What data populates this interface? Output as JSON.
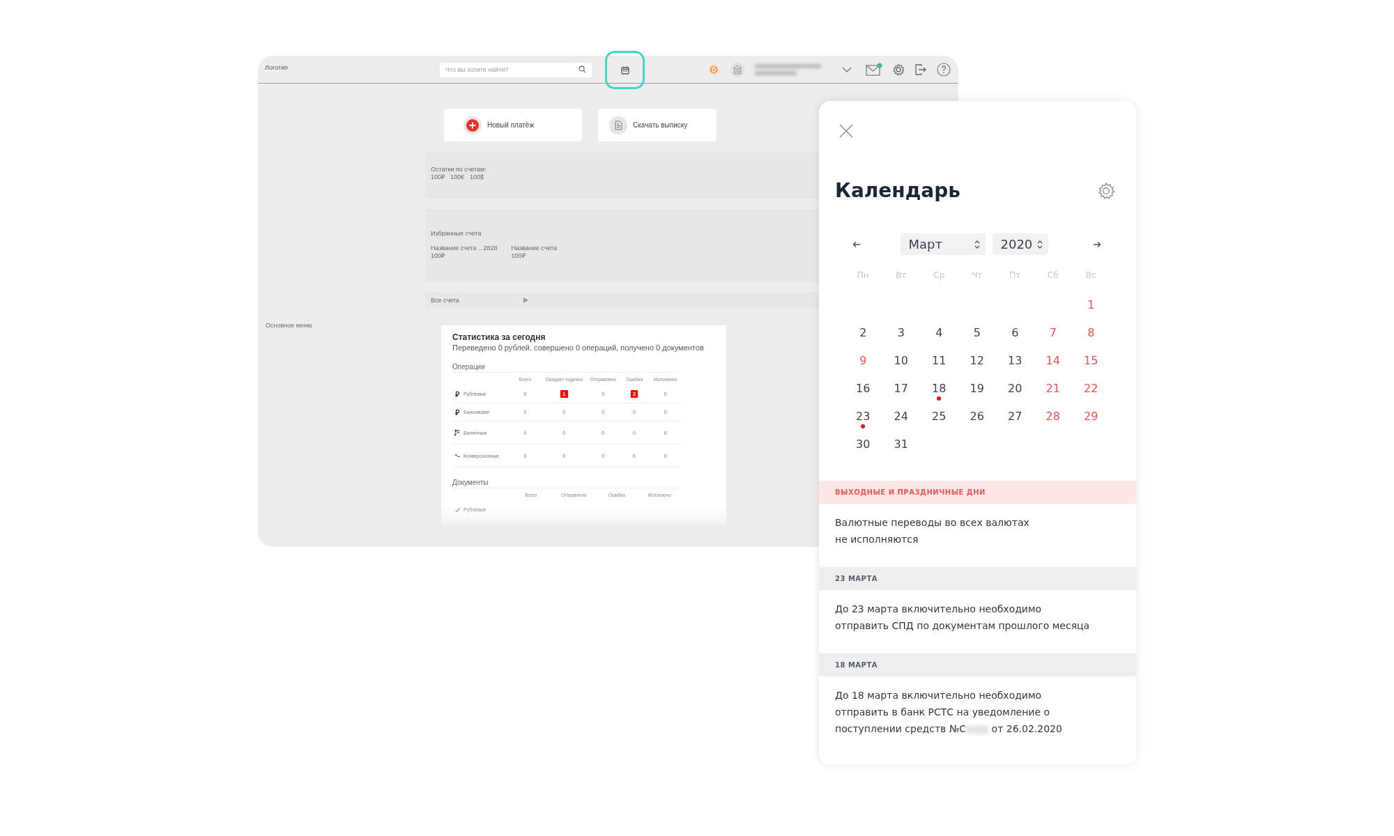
{
  "topbar": {
    "logo": "Логотип",
    "search": {
      "placeholder": "Что вы хотите найти?"
    },
    "calendar_button": {
      "selected": true
    },
    "mail": {
      "unread": true
    }
  },
  "sidebar": {
    "title": "Основное меню"
  },
  "actions": [
    {
      "kind": "new",
      "label": "Новый платёж"
    },
    {
      "kind": "download",
      "label": "Скачать выписку"
    }
  ],
  "balances": {
    "title": "Остатки по счетам:",
    "amounts": [
      "100₽",
      "100€",
      "100$"
    ]
  },
  "favorites": {
    "title": "Избранные счета",
    "accounts": [
      {
        "name": "Название счета ...2828",
        "amount": "100₽"
      },
      {
        "name": "Название счета",
        "amount": "100₽"
      }
    ]
  },
  "all_accounts": {
    "label": "Все счета"
  },
  "stats": {
    "title": "Статистика за сегодня",
    "summary": "Переведено 0 рублей, совершено 0 операций, получено 0 документов",
    "operations": {
      "title": "Операции",
      "columns": [
        "Всего",
        "Ожидает подписи",
        "Отправлено",
        "Ошибка",
        "Исполнено"
      ],
      "rows": [
        {
          "kind": "ruble",
          "label": "Рублевые",
          "cells": [
            {
              "text": "0",
              "alert": false
            },
            {
              "text": "1",
              "alert": true
            },
            {
              "text": "0",
              "alert": false
            },
            {
              "text": "2",
              "alert": true
            },
            {
              "text": "0",
              "alert": false
            }
          ]
        },
        {
          "kind": "ruble",
          "label": "Банковские",
          "cells": [
            {
              "text": "0",
              "alert": false
            },
            {
              "text": "0",
              "alert": false
            },
            {
              "text": "0",
              "alert": false
            },
            {
              "text": "0",
              "alert": false
            },
            {
              "text": "0",
              "alert": false
            }
          ]
        },
        {
          "kind": "currency",
          "label": "Валютные",
          "cells": [
            {
              "text": "0",
              "alert": false
            },
            {
              "text": "0",
              "alert": false
            },
            {
              "text": "0",
              "alert": false
            },
            {
              "text": "0",
              "alert": false
            },
            {
              "text": "0",
              "alert": false
            }
          ]
        },
        {
          "kind": "exchange",
          "label": "Конверсионные",
          "cells": [
            {
              "text": "0",
              "alert": false
            },
            {
              "text": "0",
              "alert": false
            },
            {
              "text": "0",
              "alert": false
            },
            {
              "text": "0",
              "alert": false
            },
            {
              "text": "0",
              "alert": false
            }
          ]
        }
      ]
    },
    "documents": {
      "title": "Документы",
      "columns": [
        "Всего",
        "Отправлено",
        "Ошибка",
        "Исполнено"
      ],
      "rows": [
        {
          "kind": "check",
          "label": "Рублевые"
        }
      ]
    }
  },
  "calendar": {
    "title": "Календарь",
    "month": "Март",
    "year": "2020",
    "weekdays": [
      "Пн",
      "Вт",
      "Ср",
      "Чт",
      "Пт",
      "Сб",
      "Вс"
    ],
    "weeks": [
      [
        {
          "day": "1",
          "holiday": true,
          "marked": false
        }
      ],
      [
        {
          "day": "2",
          "holiday": false,
          "marked": false
        },
        {
          "day": "3",
          "holiday": false,
          "marked": false
        },
        {
          "day": "4",
          "holiday": false,
          "marked": false
        },
        {
          "day": "5",
          "holiday": false,
          "marked": false
        },
        {
          "day": "6",
          "holiday": false,
          "marked": false
        },
        {
          "day": "7",
          "holiday": true,
          "marked": false
        },
        {
          "day": "8",
          "holiday": true,
          "marked": false
        }
      ],
      [
        {
          "day": "9",
          "holiday": true,
          "marked": false
        },
        {
          "day": "10",
          "holiday": false,
          "marked": false
        },
        {
          "day": "11",
          "holiday": false,
          "marked": false
        },
        {
          "day": "12",
          "holiday": false,
          "marked": false
        },
        {
          "day": "13",
          "holiday": false,
          "marked": false
        },
        {
          "day": "14",
          "holiday": true,
          "marked": false
        },
        {
          "day": "15",
          "holiday": true,
          "marked": false
        }
      ],
      [
        {
          "day": "16",
          "holiday": false,
          "marked": false
        },
        {
          "day": "17",
          "holiday": false,
          "marked": false
        },
        {
          "day": "18",
          "holiday": false,
          "marked": true
        },
        {
          "day": "19",
          "holiday": false,
          "marked": false
        },
        {
          "day": "20",
          "holiday": false,
          "marked": false
        },
        {
          "day": "21",
          "holiday": true,
          "marked": false
        },
        {
          "day": "22",
          "holiday": true,
          "marked": false
        }
      ],
      [
        {
          "day": "23",
          "holiday": false,
          "marked": true
        },
        {
          "day": "24",
          "holiday": false,
          "marked": false
        },
        {
          "day": "25",
          "holiday": false,
          "marked": false
        },
        {
          "day": "26",
          "holiday": false,
          "marked": false
        },
        {
          "day": "27",
          "holiday": false,
          "marked": false
        },
        {
          "day": "28",
          "holiday": true,
          "marked": false
        },
        {
          "day": "29",
          "holiday": true,
          "marked": false
        }
      ],
      [
        {
          "day": "30",
          "holiday": false,
          "marked": false
        },
        {
          "day": "31",
          "holiday": false,
          "marked": false
        }
      ]
    ],
    "notes": [
      {
        "kind": "holiday",
        "heading": "ВЫХОДНЫЕ И ПРАЗДНИЧНЫЕ ДНИ",
        "text": "Валютные переводы во всех валютах\nне исполняются"
      },
      {
        "kind": "date",
        "heading": "23 МАРТА",
        "text": "До 23 марта включительно необходимо\nотправить СПД по документам прошлого месяца"
      },
      {
        "kind": "date",
        "heading": "18 МАРТА",
        "text": "До 18 марта включительно необходимо\nотправить в банк РСТС на уведомление о\nпоступлении средств №С",
        "redacted": true,
        "text_tail": "от 26.02.2020"
      }
    ]
  }
}
